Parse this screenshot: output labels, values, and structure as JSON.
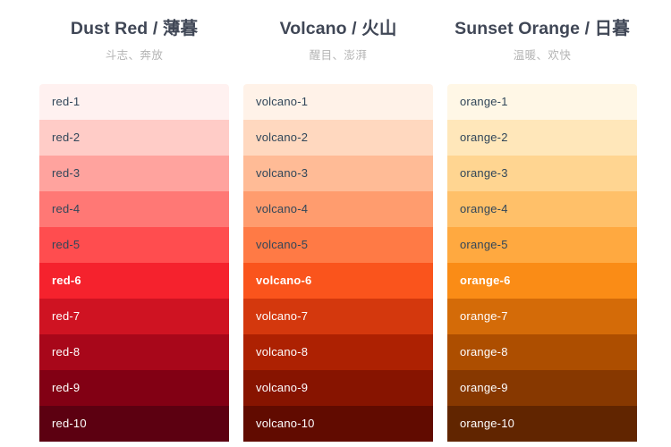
{
  "page": {
    "background": "#ffffff",
    "title_color": "#404756",
    "subtitle_color": "#b4b4b4",
    "dark_label_color": "#314659",
    "light_label_color": "#ffffff"
  },
  "palettes": [
    {
      "id": "dust-red",
      "title": "Dust Red / 薄暮",
      "subtitle": "斗志、奔放",
      "primary_index": 5,
      "swatches": [
        {
          "label": "red-1",
          "hex": "#fff1f0"
        },
        {
          "label": "red-2",
          "hex": "#ffccc7"
        },
        {
          "label": "red-3",
          "hex": "#ffa39e"
        },
        {
          "label": "red-4",
          "hex": "#ff7875"
        },
        {
          "label": "red-5",
          "hex": "#ff4d4f"
        },
        {
          "label": "red-6",
          "hex": "#f5222d"
        },
        {
          "label": "red-7",
          "hex": "#cf1322"
        },
        {
          "label": "red-8",
          "hex": "#a8071a"
        },
        {
          "label": "red-9",
          "hex": "#820014"
        },
        {
          "label": "red-10",
          "hex": "#5c0011"
        }
      ]
    },
    {
      "id": "volcano",
      "title": "Volcano / 火山",
      "subtitle": "醒目、澎湃",
      "primary_index": 5,
      "swatches": [
        {
          "label": "volcano-1",
          "hex": "#fff2e8"
        },
        {
          "label": "volcano-2",
          "hex": "#ffd8bf"
        },
        {
          "label": "volcano-3",
          "hex": "#ffbb96"
        },
        {
          "label": "volcano-4",
          "hex": "#ff9c6e"
        },
        {
          "label": "volcano-5",
          "hex": "#ff7a45"
        },
        {
          "label": "volcano-6",
          "hex": "#fa541c"
        },
        {
          "label": "volcano-7",
          "hex": "#d4380d"
        },
        {
          "label": "volcano-8",
          "hex": "#ad2102"
        },
        {
          "label": "volcano-9",
          "hex": "#871400"
        },
        {
          "label": "volcano-10",
          "hex": "#610b00"
        }
      ]
    },
    {
      "id": "sunset-orange",
      "title": "Sunset Orange / 日暮",
      "subtitle": "温暖、欢快",
      "primary_index": 5,
      "swatches": [
        {
          "label": "orange-1",
          "hex": "#fff7e6"
        },
        {
          "label": "orange-2",
          "hex": "#ffe7ba"
        },
        {
          "label": "orange-3",
          "hex": "#ffd591"
        },
        {
          "label": "orange-4",
          "hex": "#ffc069"
        },
        {
          "label": "orange-5",
          "hex": "#ffa940"
        },
        {
          "label": "orange-6",
          "hex": "#fa8c16"
        },
        {
          "label": "orange-7",
          "hex": "#d46b08"
        },
        {
          "label": "orange-8",
          "hex": "#ad4e00"
        },
        {
          "label": "orange-9",
          "hex": "#873800"
        },
        {
          "label": "orange-10",
          "hex": "#612500"
        }
      ]
    }
  ]
}
